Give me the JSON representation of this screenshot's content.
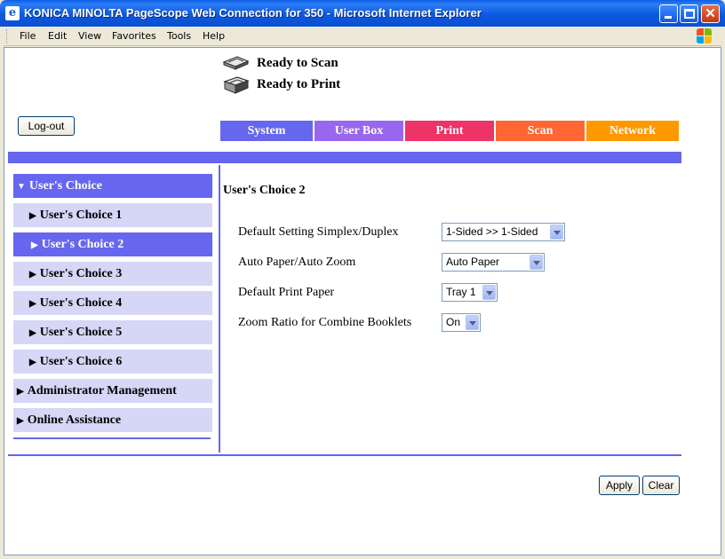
{
  "window": {
    "title": "KONICA MINOLTA PageScope Web Connection for 350 - Microsoft Internet Explorer",
    "min_glyph": "",
    "close_glyph": "✕"
  },
  "menu": [
    "File",
    "Edit",
    "View",
    "Favorites",
    "Tools",
    "Help"
  ],
  "status": {
    "scan": "Ready to Scan",
    "print": "Ready to Print"
  },
  "logout_label": "Log-out",
  "tabs": [
    {
      "label": "System",
      "color": "#6666ee"
    },
    {
      "label": "User Box",
      "color": "#9966ee"
    },
    {
      "label": "Print",
      "color": "#ee3366"
    },
    {
      "label": "Scan",
      "color": "#ff6633"
    },
    {
      "label": "Network",
      "color": "#ff9900"
    }
  ],
  "nav": [
    {
      "label": "User's Choice",
      "arrow": "▼",
      "level": 0,
      "active": true
    },
    {
      "label": "User's Choice 1",
      "arrow": "▶",
      "level": 1,
      "active": false
    },
    {
      "label": "User's Choice 2",
      "arrow": "▶",
      "level": 1,
      "active": true
    },
    {
      "label": "User's Choice 3",
      "arrow": "▶",
      "level": 1,
      "active": false
    },
    {
      "label": "User's Choice 4",
      "arrow": "▶",
      "level": 1,
      "active": false
    },
    {
      "label": "User's Choice 5",
      "arrow": "▶",
      "level": 1,
      "active": false
    },
    {
      "label": "User's Choice 6",
      "arrow": "▶",
      "level": 1,
      "active": false
    },
    {
      "label": "Administrator Management",
      "arrow": "▶",
      "level": 0,
      "active": false
    },
    {
      "label": "Online Assistance",
      "arrow": "▶",
      "level": 0,
      "active": false
    }
  ],
  "content": {
    "title": "User's Choice 2",
    "settings": [
      {
        "label": "Default Setting Simplex/Duplex",
        "value": "1-Sided >> 1-Sided"
      },
      {
        "label": "Auto Paper/Auto Zoom",
        "value": "Auto Paper"
      },
      {
        "label": "Default Print Paper",
        "value": "Tray 1"
      },
      {
        "label": "Zoom Ratio for Combine Booklets",
        "value": "On"
      }
    ]
  },
  "buttons": {
    "apply": "Apply",
    "clear": "Clear"
  },
  "colors": {
    "accent": "#6666ee",
    "nav_inactive": "#d6d6f6"
  }
}
